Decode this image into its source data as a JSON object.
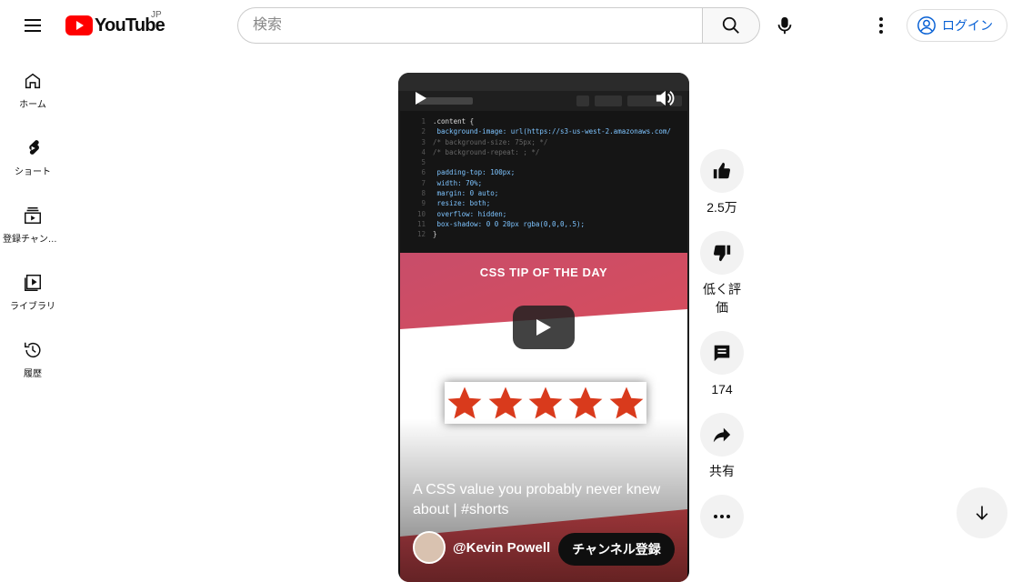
{
  "header": {
    "logo_text": "YouTube",
    "region": "JP",
    "search_placeholder": "検索",
    "login_label": "ログイン"
  },
  "sidebar": {
    "items": [
      {
        "label": "ホーム",
        "icon": "home-icon"
      },
      {
        "label": "ショート",
        "icon": "shorts-icon"
      },
      {
        "label": "登録チャンネル",
        "icon": "subscriptions-icon"
      },
      {
        "label": "ライブラリ",
        "icon": "library-icon"
      },
      {
        "label": "履歴",
        "icon": "history-icon"
      }
    ]
  },
  "video": {
    "tip_title": "CSS TIP OF THE DAY",
    "title": "A CSS value you probably never knew about | #shorts",
    "channel": "@Kevin Powell",
    "subscribe_label": "チャンネル登録",
    "code_lines": [
      {
        "n": "1",
        "text": ".content {"
      },
      {
        "n": "2",
        "text": "  background-image: url(https://s3-us-west-2.amazonaws.com/"
      },
      {
        "n": "3",
        "text": "/*   background-size: 75px; */"
      },
      {
        "n": "4",
        "text": "/*   background-repeat: ; */"
      },
      {
        "n": "5",
        "text": ""
      },
      {
        "n": "6",
        "text": "  padding-top: 100px;"
      },
      {
        "n": "7",
        "text": "  width: 70%;"
      },
      {
        "n": "8",
        "text": "  margin: 0 auto;"
      },
      {
        "n": "9",
        "text": "  resize: both;"
      },
      {
        "n": "10",
        "text": "  overflow: hidden;"
      },
      {
        "n": "11",
        "text": "  box-shadow: 0 0 20px rgba(0,0,0,.5);"
      },
      {
        "n": "12",
        "text": "}"
      }
    ]
  },
  "actions": {
    "like_count": "2.5万",
    "dislike_label": "低く評価",
    "comment_count": "174",
    "share_label": "共有"
  },
  "colors": {
    "brand_red": "#ff0000",
    "link_blue": "#065fd4",
    "star_red": "#d93a1c"
  }
}
